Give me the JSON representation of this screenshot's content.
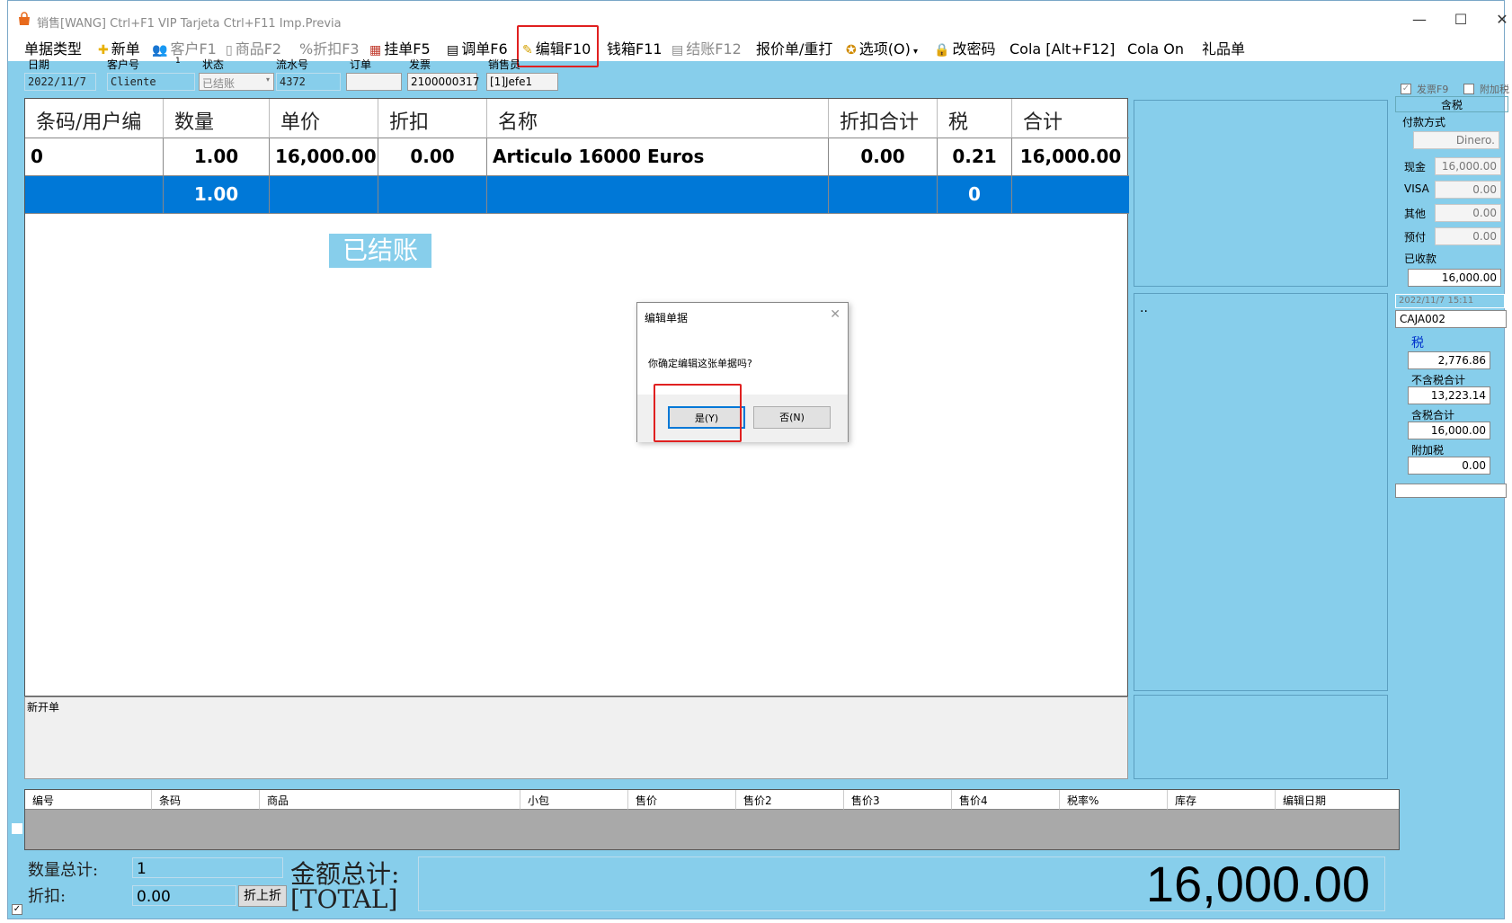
{
  "window": {
    "title": "销售[WANG]    Ctrl+F1 VIP Tarjeta   Ctrl+F11 Imp.Previa",
    "minimize": "—",
    "maximize": "☐",
    "close": "✕"
  },
  "menu": [
    {
      "label": "单据类型",
      "icon": ""
    },
    {
      "label": "新单",
      "icon": "✚"
    },
    {
      "label": "客户F1",
      "icon": "👥"
    },
    {
      "label": "商品F2",
      "icon": "▯"
    },
    {
      "label": "%折扣F3",
      "icon": ""
    },
    {
      "label": "挂单F5",
      "icon": "▦"
    },
    {
      "label": "调单F6",
      "icon": "▤"
    },
    {
      "label": "编辑F10",
      "icon": "✎"
    },
    {
      "label": "钱箱F11",
      "icon": ""
    },
    {
      "label": "结账F12",
      "icon": "▤"
    },
    {
      "label": "报价单/重打",
      "icon": ""
    },
    {
      "label": "选项(O)",
      "icon": "✪"
    },
    {
      "label": "改密码",
      "icon": "🔒"
    },
    {
      "label": "Cola [Alt+F12]",
      "icon": ""
    },
    {
      "label": "Cola On",
      "icon": ""
    },
    {
      "label": "礼品单",
      "icon": ""
    }
  ],
  "fields": {
    "date_label": "日期",
    "date_value": "2022/11/7",
    "customer_label": "客户号",
    "customer_value": "Cliente",
    "customer_count": "1",
    "status_label": "状态",
    "status_value": "已结账",
    "serial_label": "流水号",
    "serial_value": "4372",
    "order_label": "订单",
    "order_value": "",
    "invoice_label": "发票",
    "invoice_value": "2100000317",
    "seller_label": "销售员",
    "seller_value": "[1]Jefe1"
  },
  "grid": {
    "headers": [
      "条码/用户编",
      "数量",
      "单价",
      "折扣",
      "名称",
      "折扣合计",
      "税",
      "合计"
    ],
    "rows": [
      [
        "0",
        "1.00",
        "16,000.00",
        "0.00",
        "Articulo 16000 Euros",
        "0.00",
        "0.21",
        "16,000.00"
      ],
      [
        "",
        "1.00",
        "",
        "",
        "",
        "",
        "0",
        ""
      ]
    ],
    "stamp": "已结账"
  },
  "note": {
    "label": "新开单"
  },
  "side": {
    "dots": ".."
  },
  "right_panel": {
    "invoice_check": "发票F9",
    "surcharge_check": "附加税",
    "tax_included": "含税",
    "payment_method": "付款方式",
    "payment_value": "Dinero.",
    "cash_label": "现金",
    "cash_value": "16,000.00",
    "visa_label": "VISA",
    "visa_value": "0.00",
    "other_label": "其他",
    "other_value": "0.00",
    "prepaid_label": "预付",
    "prepaid_value": "0.00",
    "received_label": "已收款",
    "received_value": "16,000.00",
    "datetime": "2022/11/7 15:11",
    "register": "CAJA002",
    "tax_label": "税",
    "tax_value": "2,776.86",
    "pretax_label": "不含税合计",
    "pretax_value": "13,223.14",
    "total_tax_label": "含税合计",
    "total_tax_value": "16,000.00",
    "surcharge_label": "附加税",
    "surcharge_value": "0.00"
  },
  "list": {
    "headers": [
      "编号",
      "条码",
      "商品",
      "小包",
      "售价",
      "售价2",
      "售价3",
      "售价4",
      "税率%",
      "库存",
      "编辑日期"
    ]
  },
  "bottom": {
    "qty_label": "数量总计:",
    "qty_value": "1",
    "discount_label": "折扣:",
    "discount_value": "0.00",
    "discount_button": "折上折",
    "amount_label": "金额总计:",
    "amount_label2": "[TOTAL]",
    "total": "16,000.00"
  },
  "dialog": {
    "title": "编辑单据",
    "message": "你确定编辑这张单据吗?",
    "yes": "是(Y)",
    "no": "否(N)",
    "close": "✕"
  },
  "colors": {
    "background": "#87ceeb",
    "selected_row": "#0078d7",
    "highlight": "#e02020"
  }
}
